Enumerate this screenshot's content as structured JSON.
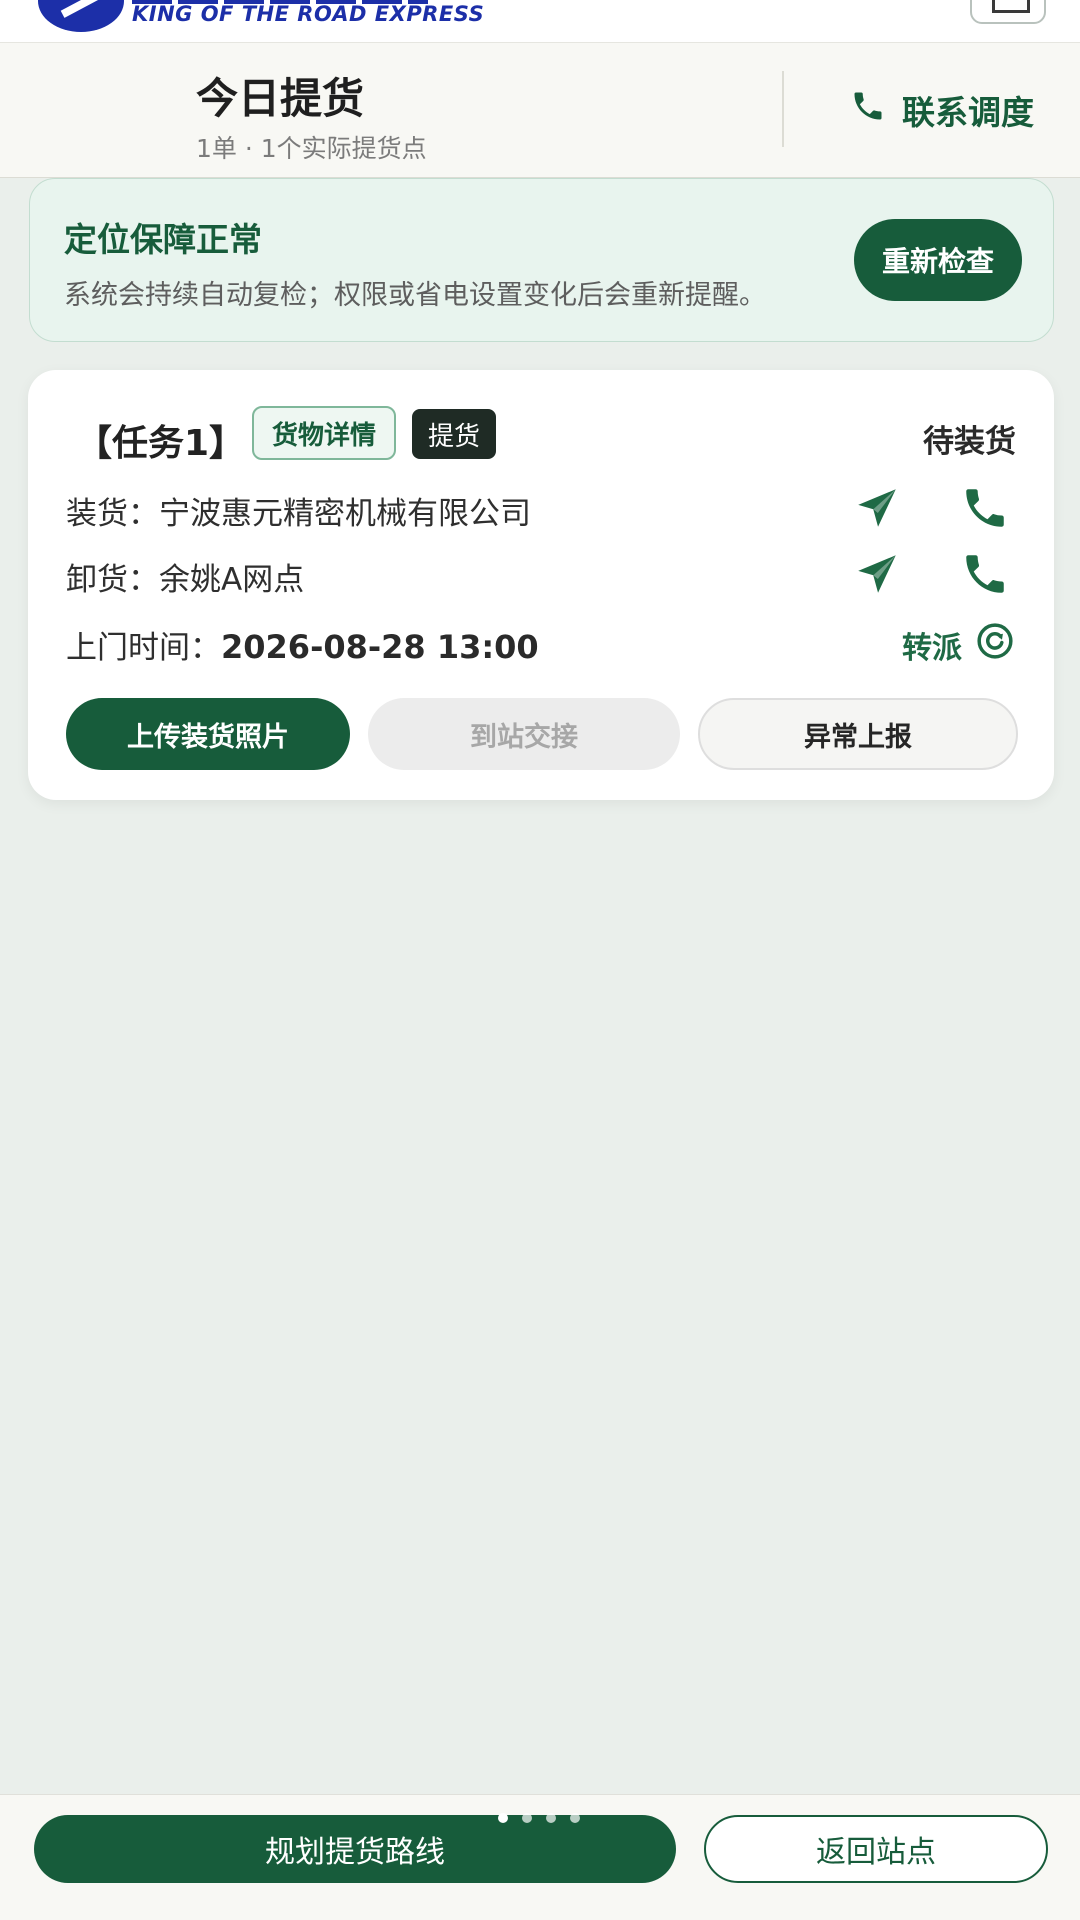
{
  "brand": {
    "text": "KING OF THE ROAD EXPRESS"
  },
  "header": {
    "title": "今日提货",
    "subtitle": "1单 · 1个实际提货点",
    "contact_label": "联系调度"
  },
  "location_banner": {
    "title": "定位保障正常",
    "description": "系统会持续自动复检；权限或省电设置变化后会重新提醒。",
    "recheck_label": "重新检查"
  },
  "task": {
    "label": "【任务1】",
    "tag_detail": "货物详情",
    "tag_type": "提货",
    "status": "待装货",
    "load_prefix": "装货：",
    "load_value": "宁波惠元精密机械有限公司",
    "unload_prefix": "卸货：",
    "unload_value": "余姚A网点",
    "time_prefix": "上门时间：",
    "time_value": "2026-08-28 13:00",
    "reassign_label": "转派",
    "actions": {
      "upload_photos": "上传装货照片",
      "arrive_handover": "到站交接",
      "report_exception": "异常上报"
    }
  },
  "bottom_bar": {
    "plan_route": "规划提货路线",
    "return_station": "返回站点",
    "page_dots": 4,
    "active_dot": 0
  },
  "colors": {
    "primary": "#175c3b",
    "background": "#eaefeb",
    "banner_bg": "#e8f4ee",
    "brand_blue": "#1c2fa8"
  },
  "icons": {
    "contact": "phone-icon",
    "navigate": "navigate-arrow-icon",
    "call": "phone-icon",
    "reassign": "refresh-circle-icon",
    "scan": "scan-icon"
  }
}
